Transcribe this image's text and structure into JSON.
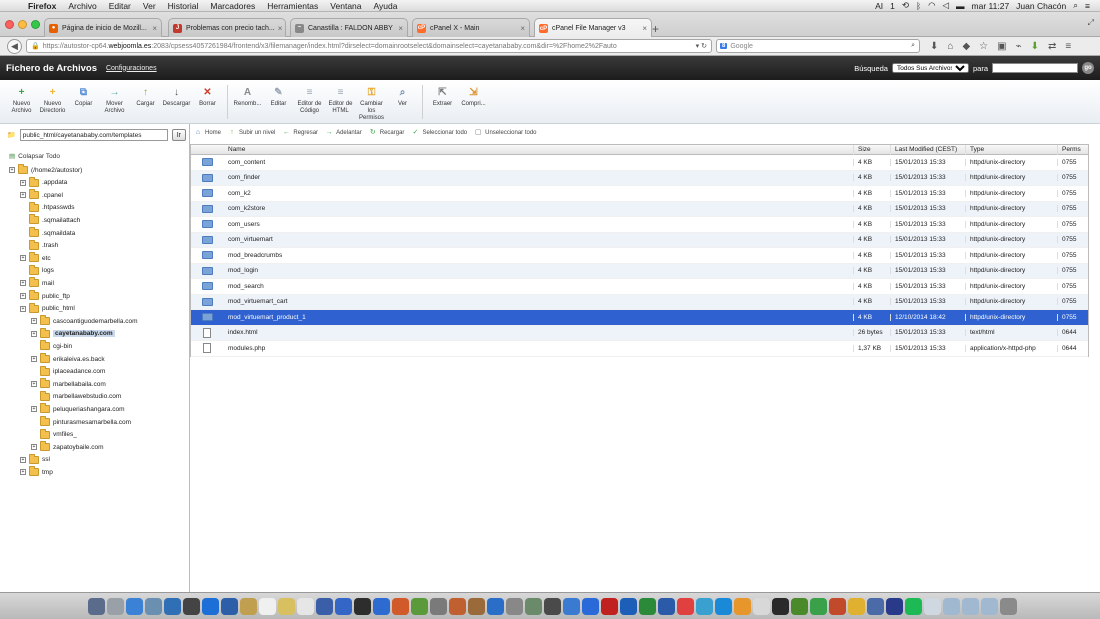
{
  "menubar": {
    "app": "Firefox",
    "items": [
      "Archivo",
      "Editar",
      "Ver",
      "Historial",
      "Marcadores",
      "Herramientas",
      "Ventana",
      "Ayuda"
    ],
    "ai_count": "1",
    "clock": "mar 11:27",
    "user": "Juan Chacón"
  },
  "tabs": [
    {
      "label": "Página de inicio de Mozill...",
      "color": "#e66000",
      "glyph": "●"
    },
    {
      "label": "Problemas con precio tach...",
      "color": "#c0392b",
      "glyph": "J"
    },
    {
      "label": "Canastilla : FALDON ABBY",
      "color": "#888888",
      "glyph": "~"
    },
    {
      "label": "cPanel X - Main",
      "color": "#ff6c2c",
      "glyph": "cP"
    },
    {
      "label": "cPanel File Manager v3",
      "color": "#ff6c2c",
      "glyph": "cP"
    }
  ],
  "url": {
    "prefix": "https://autostor-cp64.",
    "domain": "webjoomla.es",
    "rest": ":2083/cpsess4057261984/frontend/x3/filemanager/index.html?dirselect=domainrootselect&domainselect=cayetanababy.com&dir=%2Fhome2%2Fauto"
  },
  "search_placeholder": "Google",
  "cpanel": {
    "title": "Fichero de Archivos",
    "config_link": "Configuraciones",
    "search_label": "Búsqueda",
    "search_scope": "Todos Sus Archivos",
    "for_label": "para",
    "go_label": "go"
  },
  "toolbar": [
    {
      "label": "Nuevo Archivo",
      "icon": "new-file-icon",
      "color": "#3aa64a",
      "glyph": "+"
    },
    {
      "label": "Nuevo Directorio",
      "icon": "new-folder-icon",
      "color": "#f0b63a",
      "glyph": "+"
    },
    {
      "label": "Copiar",
      "icon": "copy-icon",
      "color": "#5b8fd6",
      "glyph": "⧉"
    },
    {
      "label": "Mover Archivo",
      "icon": "move-file-icon",
      "color": "#4aa3a0",
      "glyph": "→"
    },
    {
      "label": "Cargar",
      "icon": "upload-icon",
      "color": "#7bb33a",
      "glyph": "↑"
    },
    {
      "label": "Descargar",
      "icon": "download-icon",
      "color": "#555555",
      "glyph": "↓"
    },
    {
      "label": "Borrar",
      "icon": "delete-icon",
      "color": "#d03a2a",
      "glyph": "✕"
    },
    {
      "sep": true
    },
    {
      "label": "Renomb...",
      "icon": "rename-icon",
      "color": "#8a8a8a",
      "glyph": "A"
    },
    {
      "label": "Editar",
      "icon": "edit-icon",
      "color": "#9aa6b4",
      "glyph": "✎"
    },
    {
      "label": "Editor de Código",
      "icon": "code-editor-icon",
      "color": "#9aa6b4",
      "glyph": "≡"
    },
    {
      "label": "Editor de HTML",
      "icon": "html-editor-icon",
      "color": "#9aa6b4",
      "glyph": "≡"
    },
    {
      "label": "Cambiar los Permisos",
      "icon": "permissions-icon",
      "color": "#e6a82e",
      "glyph": "⚿"
    },
    {
      "label": "Ver",
      "icon": "view-icon",
      "color": "#6d8bb3",
      "glyph": "⌕"
    },
    {
      "sep": true
    },
    {
      "label": "Extraer",
      "icon": "extract-icon",
      "color": "#777777",
      "glyph": "⇱"
    },
    {
      "label": "Compri...",
      "icon": "compress-icon",
      "color": "#d9902a",
      "glyph": "⇲"
    }
  ],
  "path_value": "public_html/cayetanababy.com/templates",
  "go_button": "Ir",
  "collapse_all": "Colapsar Todo",
  "tree": [
    {
      "label": "(/home2/autostor)",
      "level": 0,
      "plus": true,
      "root": true
    },
    {
      "label": ".appdata",
      "level": 1,
      "plus": true
    },
    {
      "label": ".cpanel",
      "level": 1,
      "plus": true
    },
    {
      "label": ".htpasswds",
      "level": 1,
      "plus": false
    },
    {
      "label": ".sqmailattach",
      "level": 1,
      "plus": false
    },
    {
      "label": ".sqmaildata",
      "level": 1,
      "plus": false
    },
    {
      "label": ".trash",
      "level": 1,
      "plus": false
    },
    {
      "label": "etc",
      "level": 1,
      "plus": true
    },
    {
      "label": "logs",
      "level": 1,
      "plus": false
    },
    {
      "label": "mail",
      "level": 1,
      "plus": true
    },
    {
      "label": "public_ftp",
      "level": 1,
      "plus": true
    },
    {
      "label": "public_html",
      "level": 1,
      "plus": true
    },
    {
      "label": "cascoantiguodemarbella.com",
      "level": 2,
      "plus": true
    },
    {
      "label": "cayetanababy.com",
      "level": 2,
      "plus": true,
      "selected": true
    },
    {
      "label": "cgi-bin",
      "level": 2,
      "plus": false
    },
    {
      "label": "erikaleiva.es.back",
      "level": 2,
      "plus": true
    },
    {
      "label": "iplaceadance.com",
      "level": 2,
      "plus": false
    },
    {
      "label": "marbellabaila.com",
      "level": 2,
      "plus": true
    },
    {
      "label": "marbellawebstudio.com",
      "level": 2,
      "plus": false
    },
    {
      "label": "peluqueriashangara.com",
      "level": 2,
      "plus": true
    },
    {
      "label": "pinturasmesamarbella.com",
      "level": 2,
      "plus": false
    },
    {
      "label": "vmfiles_",
      "level": 2,
      "plus": false
    },
    {
      "label": "zapatoybaile.com",
      "level": 2,
      "plus": true
    },
    {
      "label": "ssl",
      "level": 1,
      "plus": true
    },
    {
      "label": "tmp",
      "level": 1,
      "plus": true
    }
  ],
  "subtoolbar": [
    {
      "label": "Home",
      "icon": "home-icon",
      "color": "#4a7ab8",
      "glyph": "⌂"
    },
    {
      "label": "Subir un nivel",
      "icon": "up-level-icon",
      "color": "#7bb33a",
      "glyph": "↑"
    },
    {
      "label": "Regresar",
      "icon": "back-icon",
      "color": "#3aa64a",
      "glyph": "←"
    },
    {
      "label": "Adelantar",
      "icon": "forward-icon",
      "color": "#3aa64a",
      "glyph": "→"
    },
    {
      "label": "Recargar",
      "icon": "reload-icon",
      "color": "#3aa64a",
      "glyph": "↻"
    },
    {
      "label": "Seleccionar todo",
      "icon": "select-all-icon",
      "color": "#3aa64a",
      "glyph": "✓"
    },
    {
      "label": "Unseleccionar todo",
      "icon": "unselect-all-icon",
      "color": "#777777",
      "glyph": "▢"
    }
  ],
  "columns": {
    "name": "Name",
    "size": "Size",
    "modified": "Last Modified (CEST)",
    "type": "Type",
    "perms": "Perms"
  },
  "files": [
    {
      "name": "com_content",
      "size": "4 KB",
      "modified": "15/01/2013 15:33",
      "type": "httpd/unix-directory",
      "perms": "0755",
      "kind": "folder"
    },
    {
      "name": "com_finder",
      "size": "4 KB",
      "modified": "15/01/2013 15:33",
      "type": "httpd/unix-directory",
      "perms": "0755",
      "kind": "folder"
    },
    {
      "name": "com_k2",
      "size": "4 KB",
      "modified": "15/01/2013 15:33",
      "type": "httpd/unix-directory",
      "perms": "0755",
      "kind": "folder"
    },
    {
      "name": "com_k2store",
      "size": "4 KB",
      "modified": "15/01/2013 15:33",
      "type": "httpd/unix-directory",
      "perms": "0755",
      "kind": "folder"
    },
    {
      "name": "com_users",
      "size": "4 KB",
      "modified": "15/01/2013 15:33",
      "type": "httpd/unix-directory",
      "perms": "0755",
      "kind": "folder"
    },
    {
      "name": "com_virtuemart",
      "size": "4 KB",
      "modified": "15/01/2013 15:33",
      "type": "httpd/unix-directory",
      "perms": "0755",
      "kind": "folder"
    },
    {
      "name": "mod_breadcrumbs",
      "size": "4 KB",
      "modified": "15/01/2013 15:33",
      "type": "httpd/unix-directory",
      "perms": "0755",
      "kind": "folder"
    },
    {
      "name": "mod_login",
      "size": "4 KB",
      "modified": "15/01/2013 15:33",
      "type": "httpd/unix-directory",
      "perms": "0755",
      "kind": "folder"
    },
    {
      "name": "mod_search",
      "size": "4 KB",
      "modified": "15/01/2013 15:33",
      "type": "httpd/unix-directory",
      "perms": "0755",
      "kind": "folder"
    },
    {
      "name": "mod_virtuemart_cart",
      "size": "4 KB",
      "modified": "15/01/2013 15:33",
      "type": "httpd/unix-directory",
      "perms": "0755",
      "kind": "folder"
    },
    {
      "name": "mod_virtuemart_product_1",
      "size": "4 KB",
      "modified": "12/10/2014 18:42",
      "type": "httpd/unix-directory",
      "perms": "0755",
      "kind": "folder",
      "selected": true
    },
    {
      "name": "index.html",
      "size": "26 bytes",
      "modified": "15/01/2013 15:33",
      "type": "text/html",
      "perms": "0644",
      "kind": "file"
    },
    {
      "name": "modules.php",
      "size": "1,37 KB",
      "modified": "15/01/2013 15:33",
      "type": "application/x-httpd-php",
      "perms": "0644",
      "kind": "php"
    }
  ],
  "dock_colors": [
    "#5a6b8c",
    "#9aa0a8",
    "#3b82d6",
    "#6a8fb0",
    "#2f6fb5",
    "#444444",
    "#1d6fd8",
    "#2c5fa8",
    "#c0a050",
    "#f0f0f0",
    "#d8c060",
    "#e6e6e6",
    "#3a5fa8",
    "#3466c8",
    "#2d2d2d",
    "#2e6bd0",
    "#d05a2a",
    "#5a9a3a",
    "#7a7a7a",
    "#c06030",
    "#9a6a3a",
    "#2b6ec8",
    "#888888",
    "#6a8a6a",
    "#4a4a4a",
    "#3a7ad0",
    "#2a6ad8",
    "#c02020",
    "#1d5fb8",
    "#2a8a3a",
    "#2a5aa8",
    "#e04040",
    "#3aa0d0",
    "#1a8ad8",
    "#e6962a",
    "#d8d8d8",
    "#2a2a2a",
    "#4a8a2a",
    "#3aa04a",
    "#c04a2a",
    "#e0b030",
    "#4a6aa8",
    "#2a3a8a",
    "#1db954",
    "#cfd8e0",
    "#a0b8d0",
    "#a0b8d0",
    "#a0b8d0",
    "#8a8a8a"
  ]
}
